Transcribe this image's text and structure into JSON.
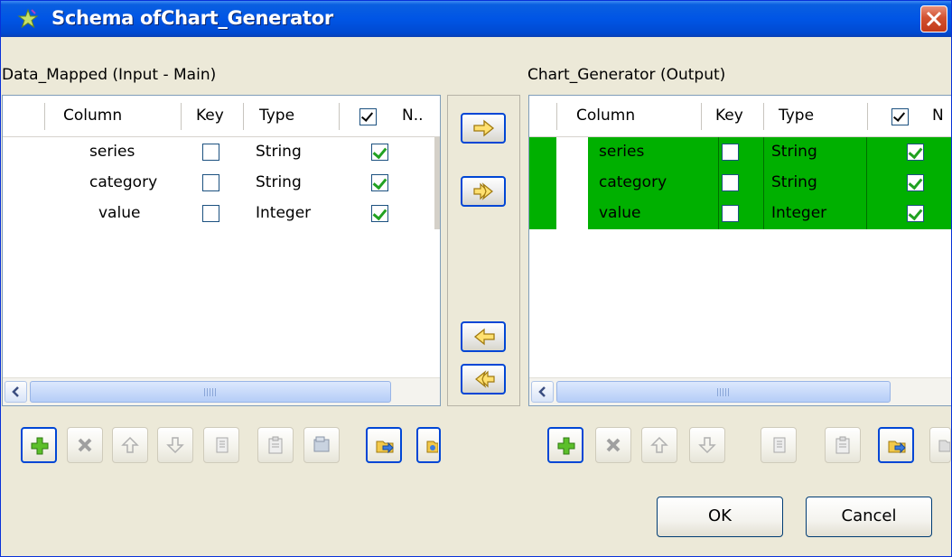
{
  "window": {
    "title": "Schema ofChart_Generator"
  },
  "left_panel": {
    "label": "Data_Mapped (Input - Main)",
    "columns": {
      "column": "Column",
      "key": "Key",
      "type": "Type",
      "nullable": "N.."
    },
    "rows": [
      {
        "column": "series",
        "key": false,
        "type": "String",
        "nullable": true
      },
      {
        "column": "category",
        "key": false,
        "type": "String",
        "nullable": true
      },
      {
        "column": "value",
        "key": false,
        "type": "Integer",
        "nullable": true
      }
    ]
  },
  "right_panel": {
    "label": "Chart_Generator (Output)",
    "columns": {
      "column": "Column",
      "key": "Key",
      "type": "Type",
      "nullable": "N"
    },
    "rows": [
      {
        "column": "series",
        "key": false,
        "type": "String",
        "nullable": true
      },
      {
        "column": "category",
        "key": false,
        "type": "String",
        "nullable": true
      },
      {
        "column": "value",
        "key": false,
        "type": "Integer",
        "nullable": true
      }
    ],
    "highlight_color": "#00b000"
  },
  "transfer_buttons": [
    "copy-selected-right",
    "copy-all-right",
    "copy-selected-left",
    "copy-all-left"
  ],
  "toolbar_icons": [
    "add-icon",
    "delete-icon",
    "move-up-icon",
    "move-down-icon",
    "copy-icon",
    "paste-icon",
    "import-icon",
    "export-icon"
  ],
  "buttons": {
    "ok": "OK",
    "cancel": "Cancel"
  }
}
